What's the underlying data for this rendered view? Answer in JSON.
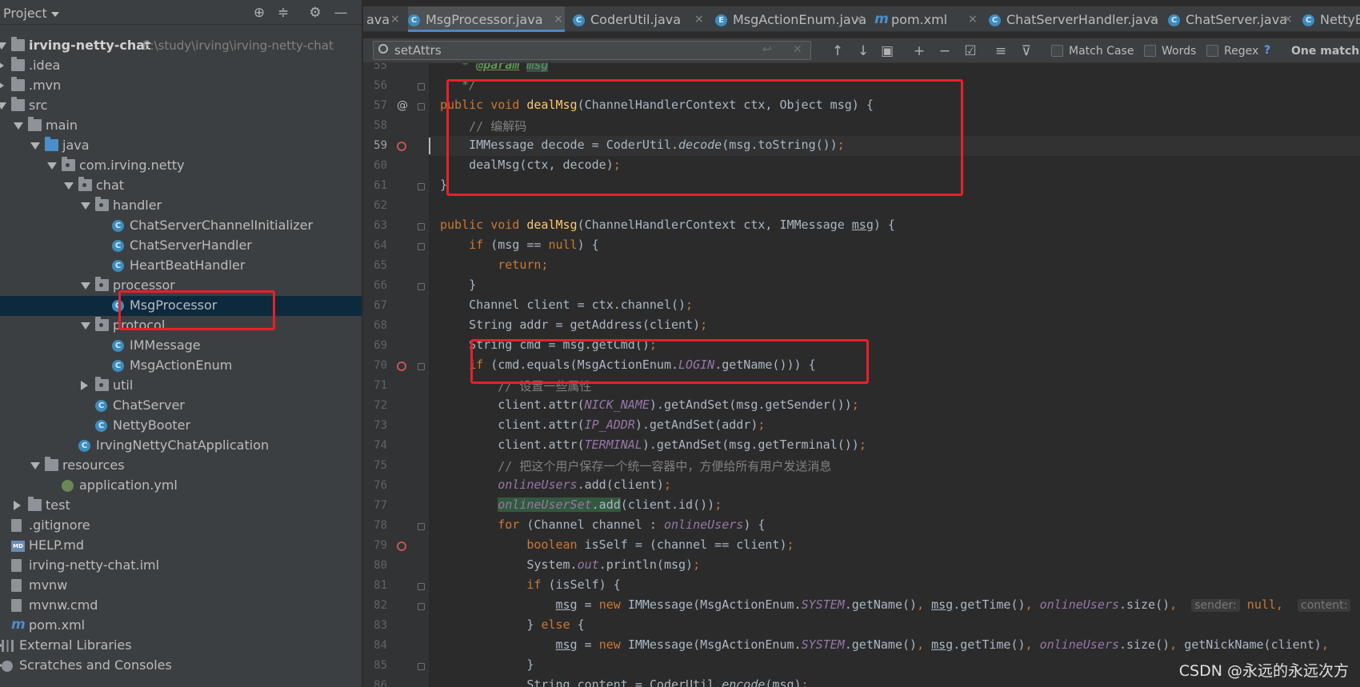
{
  "project_panel": {
    "title": "Project",
    "tree": [
      {
        "label": "irving-netty-chat",
        "path": "E:\\study\\irving\\irving-netty-chat",
        "icon": "folder-icon",
        "depth": 0,
        "arrow": "down",
        "bold": true
      },
      {
        "label": ".idea",
        "icon": "folder-icon",
        "depth": 0,
        "arrow": "right"
      },
      {
        "label": ".mvn",
        "icon": "folder-icon",
        "depth": 0,
        "arrow": "right"
      },
      {
        "label": "src",
        "icon": "folder-icon",
        "depth": 0,
        "arrow": "down"
      },
      {
        "label": "main",
        "icon": "folder-icon",
        "depth": 1,
        "arrow": "down"
      },
      {
        "label": "java",
        "icon": "source-folder-icon",
        "depth": 2,
        "arrow": "down"
      },
      {
        "label": "com.irving.netty",
        "icon": "package-icon",
        "depth": 3,
        "arrow": "down"
      },
      {
        "label": "chat",
        "icon": "package-icon",
        "depth": 4,
        "arrow": "down"
      },
      {
        "label": "handler",
        "icon": "package-icon",
        "depth": 5,
        "arrow": "down"
      },
      {
        "label": "ChatServerChannelInitializer",
        "icon": "class-icon",
        "depth": 6
      },
      {
        "label": "ChatServerHandler",
        "icon": "class-icon",
        "depth": 6
      },
      {
        "label": "HeartBeatHandler",
        "icon": "class-icon",
        "depth": 6
      },
      {
        "label": "processor",
        "icon": "package-icon",
        "depth": 5,
        "arrow": "down"
      },
      {
        "label": "MsgProcessor",
        "icon": "class-icon",
        "depth": 6,
        "selected": true
      },
      {
        "label": "protocol",
        "icon": "package-icon",
        "depth": 5,
        "arrow": "down"
      },
      {
        "label": "IMMessage",
        "icon": "class-icon",
        "depth": 6
      },
      {
        "label": "MsgActionEnum",
        "icon": "class-icon",
        "depth": 6
      },
      {
        "label": "util",
        "icon": "package-icon",
        "depth": 5,
        "arrow": "right"
      },
      {
        "label": "ChatServer",
        "icon": "class-icon",
        "depth": 5
      },
      {
        "label": "NettyBooter",
        "icon": "class-icon",
        "depth": 5
      },
      {
        "label": "IrvingNettyChatApplication",
        "icon": "spring-class-icon",
        "depth": 4
      },
      {
        "label": "resources",
        "icon": "resources-folder-icon",
        "depth": 2,
        "arrow": "down"
      },
      {
        "label": "application.yml",
        "icon": "yml-file-icon",
        "depth": 3
      },
      {
        "label": "test",
        "icon": "folder-icon",
        "depth": 1,
        "arrow": "right"
      },
      {
        "label": ".gitignore",
        "icon": "file-icon",
        "depth": 0
      },
      {
        "label": "HELP.md",
        "icon": "markdown-file-icon",
        "depth": 0
      },
      {
        "label": "irving-netty-chat.iml",
        "icon": "file-icon",
        "depth": 0
      },
      {
        "label": "mvnw",
        "icon": "file-icon",
        "depth": 0
      },
      {
        "label": "mvnw.cmd",
        "icon": "file-icon",
        "depth": 0
      },
      {
        "label": "pom.xml",
        "icon": "maven-icon",
        "depth": 0
      },
      {
        "label": "External Libraries",
        "icon": "library-icon",
        "depth": -1,
        "arrow": "right"
      },
      {
        "label": "Scratches and Consoles",
        "icon": "scratch-icon",
        "depth": -1,
        "arrow": "right"
      }
    ]
  },
  "tabs": [
    {
      "label": "ava",
      "partial": true
    },
    {
      "label": "MsgProcessor.java",
      "active": true
    },
    {
      "label": "CoderUtil.java"
    },
    {
      "label": "MsgActionEnum.java"
    },
    {
      "label": "pom.xml"
    },
    {
      "label": "ChatServerHandler.java"
    },
    {
      "label": "ChatServer.java"
    },
    {
      "label": "NettyBo"
    }
  ],
  "search": {
    "query": "setAttrs",
    "match_case": "Match Case",
    "words": "Words",
    "regex": "Regex",
    "help": "?",
    "result": "One match"
  },
  "editor": {
    "current_line": 59,
    "lines": [
      {
        "n": 55,
        "html": "   <span class=\"doc\">* </span><span class=\"docp\">@param</span><span class=\"doc\"> </span><span class=\"hl-word doc\">msg</span>"
      },
      {
        "n": 56,
        "html": "   <span class=\"doc\">*/</span>"
      },
      {
        "n": 57,
        "html": "<span class=\"kw\">public void </span><span class=\"fn\">dealMsg</span>(ChannelHandlerContext ctx, Object msg) {"
      },
      {
        "n": 58,
        "html": "    <span class=\"cm\">// 编解码</span>"
      },
      {
        "n": 59,
        "html": "    IMMessage decode = CoderUtil.<i>decode</i>(msg.toString())<span class=\"kw\">;</span>"
      },
      {
        "n": 60,
        "html": "    dealMsg(ctx, decode)<span class=\"kw\">;</span>"
      },
      {
        "n": 61,
        "html": "}"
      },
      {
        "n": 62,
        "html": ""
      },
      {
        "n": 63,
        "html": "<span class=\"kw\">public void </span><span class=\"fn\">dealMsg</span>(ChannelHandlerContext ctx, IMMessage <span class=\"ul\">msg</span>) {"
      },
      {
        "n": 64,
        "html": "    <span class=\"kw\">if </span>(msg == <span class=\"kw\">null</span>) {"
      },
      {
        "n": 65,
        "html": "        <span class=\"kw\">return;</span>"
      },
      {
        "n": 66,
        "html": "    }"
      },
      {
        "n": 67,
        "html": "    Channel client = ctx.channel()<span class=\"kw\">;</span>"
      },
      {
        "n": 68,
        "html": "    String addr = getAddress(client)<span class=\"kw\">;</span>"
      },
      {
        "n": 69,
        "html": "    String cmd = msg.getCmd()<span class=\"kw\">;</span>"
      },
      {
        "n": 70,
        "html": "    <span class=\"kw\">if </span>(cmd.equals(MsgActionEnum.<span class=\"fld\">LOGIN</span>.getName())) {"
      },
      {
        "n": 71,
        "html": "        <span class=\"cm\">// 设置一些属性</span>"
      },
      {
        "n": 72,
        "html": "        client.attr(<span class=\"fld\">NICK_NAME</span>).getAndSet(msg.getSender())<span class=\"kw\">;</span>"
      },
      {
        "n": 73,
        "html": "        client.attr(<span class=\"fld\">IP_ADDR</span>).getAndSet(addr)<span class=\"kw\">;</span>"
      },
      {
        "n": 74,
        "html": "        client.attr(<span class=\"fld\">TERMINAL</span>).getAndSet(msg.getTerminal())<span class=\"kw\">;</span>"
      },
      {
        "n": 75,
        "html": "        <span class=\"cm\">// 把这个用户保存一个统一容器中，方便给所有用户发送消息</span>"
      },
      {
        "n": 76,
        "html": "        <span class=\"fld\">onlineUsers</span>.add(client)<span class=\"kw\">;</span>"
      },
      {
        "n": 77,
        "html": "        <span class=\"fld search-hit\">onlineUserSet</span><span class=\"search-hit\">.add</span>(client.id())<span class=\"kw\">;</span>"
      },
      {
        "n": 78,
        "html": "        <span class=\"kw\">for </span>(Channel channel : <span class=\"fld\">onlineUsers</span>) {"
      },
      {
        "n": 79,
        "html": "            <span class=\"kw\">boolean </span>isSelf = (channel == client)<span class=\"kw\">;</span>"
      },
      {
        "n": 80,
        "html": "            System.<span class=\"fld\">out</span>.println(msg)<span class=\"kw\">;</span>"
      },
      {
        "n": 81,
        "html": "            <span class=\"kw\">if </span>(isSelf) {"
      },
      {
        "n": 82,
        "html": "                <span class=\"ul\">msg</span> = <span class=\"kw\">new </span>IMMessage(MsgActionEnum.<span class=\"fld\">SYSTEM</span>.getName()<span class=\"kw\">, </span><span class=\"ul\">msg</span>.getTime()<span class=\"kw\">, </span><span class=\"fld\">onlineUsers</span>.size()<span class=\"kw\">,</span>  <span class=\"hint\">sender:</span> <span class=\"kw\">null,</span>  <span class=\"hint\">content:</span>"
      },
      {
        "n": 83,
        "html": "            } <span class=\"kw\">else </span>{"
      },
      {
        "n": 84,
        "html": "                <span class=\"ul\">msg</span> = <span class=\"kw\">new </span>IMMessage(MsgActionEnum.<span class=\"fld\">SYSTEM</span>.getName()<span class=\"kw\">, </span><span class=\"ul\">msg</span>.getTime()<span class=\"kw\">, </span><span class=\"fld\">onlineUsers</span>.size()<span class=\"kw\">, </span>getNickName(client)<span class=\"kw\">,</span>"
      },
      {
        "n": 85,
        "html": "            }"
      },
      {
        "n": 86,
        "html": "            String content = CoderUtil.<i>encode</i>(msg)<span class=\"kw\">;</span>"
      }
    ],
    "breakpoint_lines": [
      59,
      70,
      79
    ],
    "override_lines": [
      57
    ],
    "fold_lines": [
      56,
      57,
      61,
      63,
      64,
      66,
      70,
      78,
      81,
      82,
      85
    ]
  },
  "watermark": "CSDN @永远的永远次方",
  "accent": "#4a88c7"
}
